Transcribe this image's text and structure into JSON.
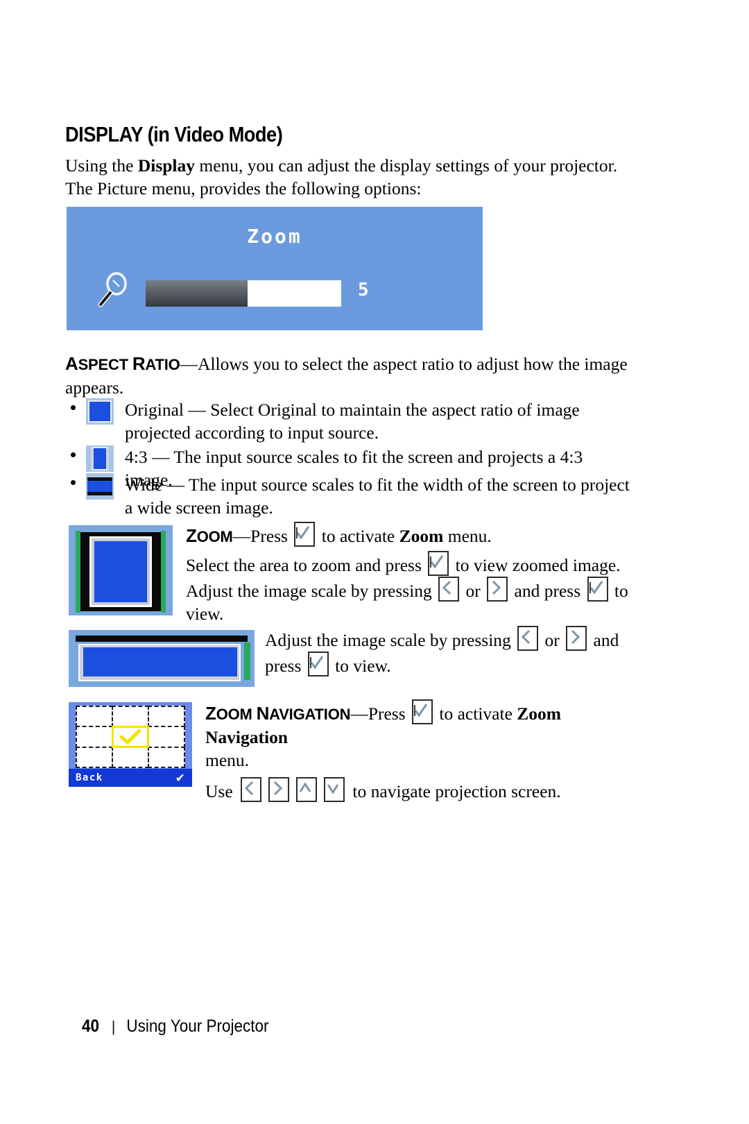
{
  "page": {
    "heading": "DISPLAY (in Video Mode)",
    "intro_part1": "Using the ",
    "intro_bold": "Display",
    "intro_part2": " menu, you can adjust the display settings of your projector. The Picture menu, provides the following options:"
  },
  "osd": {
    "title": "Zoom",
    "value": "5",
    "fill_percent": 52,
    "bg_color": "#6b9ade",
    "icon": "magnifier-icon"
  },
  "aspect_ratio": {
    "term": "Aspect Ratio",
    "term_caps_a": "A",
    "term_rest1": "SPECT ",
    "term_caps_r": "R",
    "term_rest2": "ATIO",
    "dash": "—",
    "description": "Allows you to select the aspect ratio to adjust how the image appears.",
    "options": [
      {
        "icon": "aspect-original-icon",
        "text": "Original — Select Original to maintain the aspect ratio of image projected according to input source."
      },
      {
        "icon": "aspect-4-3-icon",
        "text": "4:3 — The input source scales to fit the screen and projects a 4:3 image."
      },
      {
        "icon": "aspect-wide-icon",
        "text": "Wide — The input source scales to fit the width of the screen to project a wide screen image."
      }
    ]
  },
  "zoom_section": {
    "term_caps_z": "Z",
    "term_rest": "OOM",
    "dash": "—",
    "press_label": "Press ",
    "activate_label": " to activate ",
    "zoom_word": "Zoom",
    "menu_word": " menu.",
    "line_select": "Select the area to zoom and press ",
    "line_select_end": " to view zoomed image.",
    "line_adjust_a": "Adjust the image scale by pressing ",
    "line_adjust_or": " or ",
    "line_adjust_b": " and press ",
    "line_adjust_end": " to view."
  },
  "wide_block": {
    "line_a": "Adjust the image scale by pressing ",
    "or": " or ",
    "line_b": " and press ",
    "line_end": " to view."
  },
  "zoom_navigation": {
    "term_caps_z": "Z",
    "term_rest1": "OOM ",
    "term_caps_n": "N",
    "term_rest2": "AVIGATION",
    "dash": "—",
    "press_label": "Press ",
    "activate_label": " to activate ",
    "bold_term": "Zoom Navigation",
    "menu_word": "menu.",
    "use_label": "Use ",
    "use_end": " to navigate projection screen."
  },
  "figures": {
    "fig_43": "projection-screen-4-3-figure",
    "fig_wide": "projection-screen-wide-figure",
    "fig_nav": "zoom-navigation-grid-figure",
    "nav_back_label": "Back",
    "nav_back_check": "✔"
  },
  "keys": {
    "enter": "enter-key-icon",
    "left": "left-arrow-key-icon",
    "right": "right-arrow-key-icon",
    "up": "up-arrow-key-icon",
    "down": "down-arrow-key-icon"
  },
  "footer": {
    "page_number": "40",
    "separator": "|",
    "title": "Using Your Projector"
  }
}
